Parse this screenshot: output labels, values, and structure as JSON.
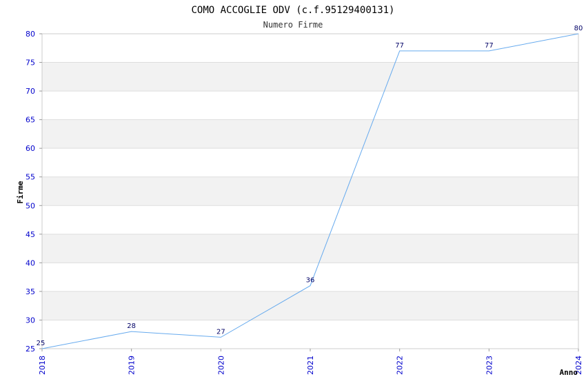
{
  "chart_data": {
    "type": "line",
    "title": "COMO ACCOGLIE ODV (c.f.95129400131)",
    "subtitle": "Numero Firme",
    "xlabel": "Anno",
    "ylabel": "Firme",
    "x": [
      "2018",
      "2019",
      "2020",
      "2021",
      "2022",
      "2023",
      "2024"
    ],
    "values": [
      25,
      28,
      27,
      36,
      77,
      77,
      80
    ],
    "ylim": [
      25,
      80
    ],
    "yticks": [
      25,
      30,
      35,
      40,
      45,
      50,
      55,
      60,
      65,
      70,
      75,
      80
    ],
    "grid": true,
    "line_color": "#66aaee",
    "band_color": "#f2f2f2",
    "tick_color": "#0000cc"
  }
}
